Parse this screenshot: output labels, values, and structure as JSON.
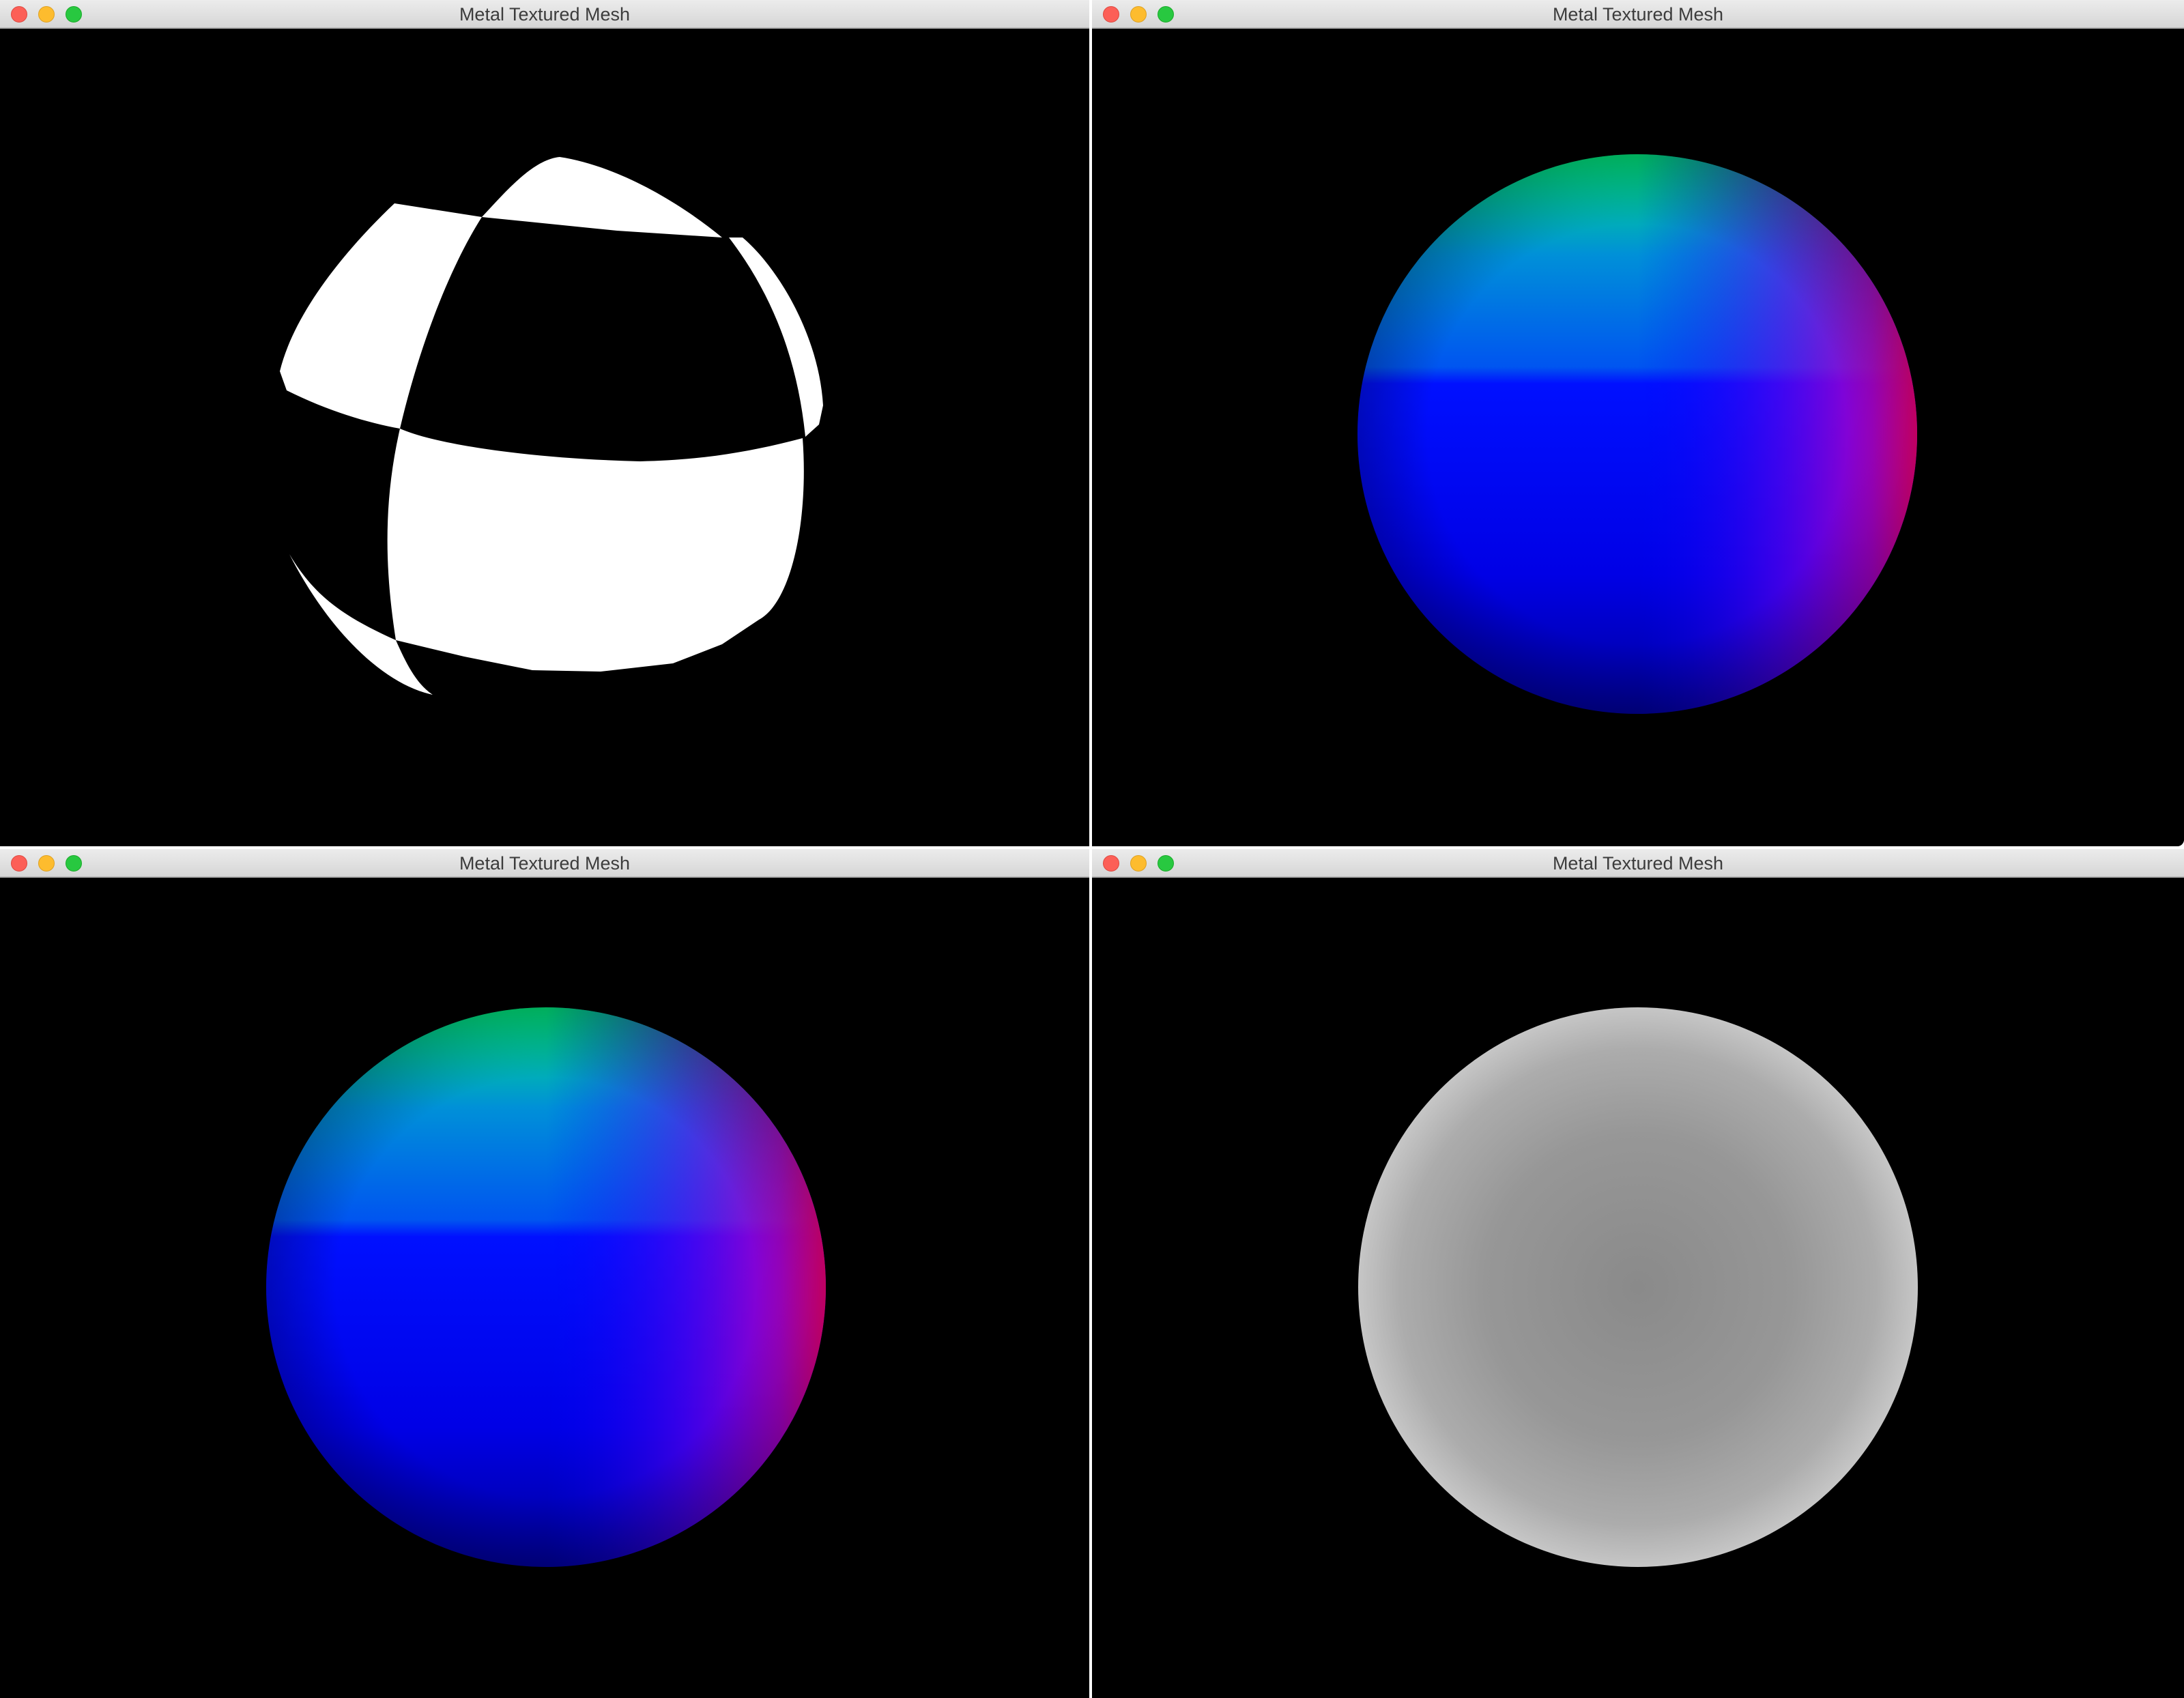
{
  "windows": [
    {
      "id": "checker",
      "title": "Metal Textured Mesh",
      "shading": "checkerboard texture",
      "colors": {
        "fill": "#ffffff",
        "background": "#000000"
      }
    },
    {
      "id": "normals-1",
      "title": "Metal Textured Mesh",
      "shading": "normal-color gradient",
      "colors": {
        "top": "#00e57a",
        "center": "#0000ff",
        "right": "#ff0080",
        "background": "#000000"
      }
    },
    {
      "id": "normals-2",
      "title": "Metal Textured Mesh",
      "shading": "normal-color gradient",
      "colors": {
        "top": "#00e57a",
        "center": "#0000ff",
        "right": "#ff0080",
        "background": "#000000"
      }
    },
    {
      "id": "depth",
      "title": "Metal Textured Mesh",
      "shading": "gray depth",
      "colors": {
        "center": "#8c8c8c",
        "edge": "#c2c2c2",
        "background": "#000000"
      }
    }
  ],
  "icons": {
    "close": "close-icon",
    "minimize": "minimize-icon",
    "zoom": "zoom-icon"
  }
}
